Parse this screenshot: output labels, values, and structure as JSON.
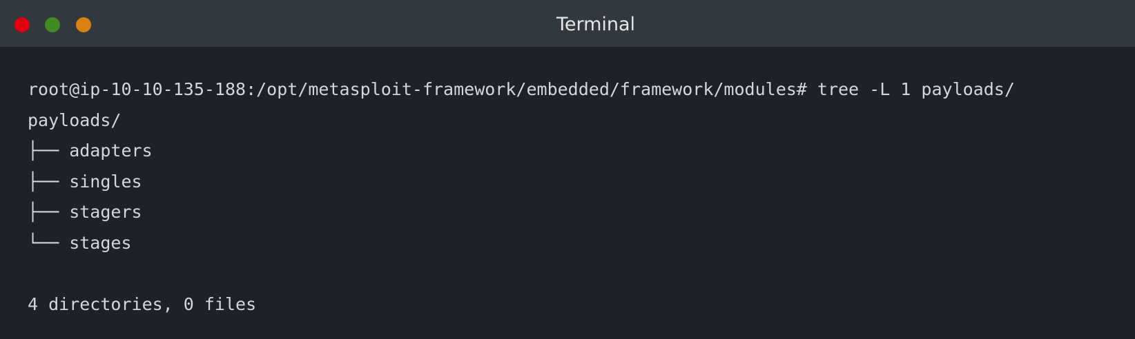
{
  "window": {
    "title": "Terminal",
    "controls": {
      "close_color": "#e0000f",
      "minimize_color": "#3f8a21",
      "maximize_color": "#d98113"
    }
  },
  "terminal": {
    "prompt_line": "root@ip-10-10-135-188:/opt/metasploit-framework/embedded/framework/modules# tree -L 1 payloads/",
    "tree_root": "payloads/",
    "tree_entries": [
      "├── adapters",
      "├── singles",
      "├── stagers",
      "└── stages"
    ],
    "summary": "4 directories, 0 files"
  }
}
